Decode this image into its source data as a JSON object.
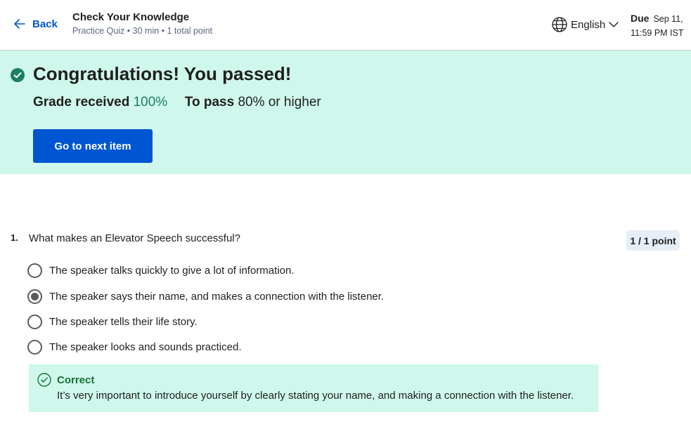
{
  "header": {
    "back_label": "Back",
    "title": "Check Your Knowledge",
    "subtitle": "Practice Quiz • 30 min • 1 total point",
    "language": "English",
    "due_label": "Due",
    "due_date": "Sep 11,",
    "due_time": "11:59 PM IST"
  },
  "banner": {
    "heading": "Congratulations! You passed!",
    "grade_label": "Grade received",
    "grade_value": "100%",
    "pass_label": "To pass",
    "pass_value": "80% or higher",
    "next_button": "Go to next item",
    "background_color": "#cff7ec"
  },
  "question": {
    "number": "1.",
    "text": "What makes an Elevator Speech successful?",
    "points": "1 / 1 point",
    "options": [
      {
        "label": "The speaker talks quickly to give a lot of information.",
        "selected": false
      },
      {
        "label": "The speaker says their name, and makes a connection with the listener.",
        "selected": true
      },
      {
        "label": "The speaker tells their life story.",
        "selected": false
      },
      {
        "label": "The speaker looks and sounds practiced.",
        "selected": false
      }
    ],
    "feedback": {
      "status": "Correct",
      "text": "It’s very important to introduce yourself by clearly stating your name, and making a connection with the listener."
    }
  },
  "colors": {
    "accent": "#0056d2",
    "success_green": "#1e7f61",
    "correct_text": "#137333"
  },
  "icons": {
    "back": "arrow-left-icon",
    "language": "globe-icon",
    "dropdown": "chevron-down-icon",
    "passed": "check-circle-icon",
    "correct": "check-circle-outline-icon"
  }
}
